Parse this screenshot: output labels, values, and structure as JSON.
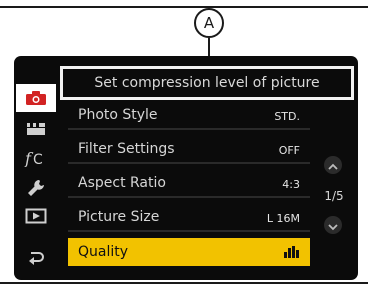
{
  "callout": {
    "label": "A"
  },
  "title": "Set compression level of picture",
  "sidebar": {
    "items": [
      {
        "icon": "camera-icon",
        "active": true
      },
      {
        "icon": "motion-picture-icon",
        "active": false
      },
      {
        "icon": "custom-fc-icon",
        "active": false
      },
      {
        "icon": "wrench-setup-icon",
        "active": false
      },
      {
        "icon": "playback-icon",
        "active": false
      },
      {
        "icon": "return-icon",
        "active": false
      }
    ]
  },
  "menu": {
    "items": [
      {
        "label": "Photo Style",
        "value": "STD."
      },
      {
        "label": "Filter Settings",
        "value": "OFF"
      },
      {
        "label": "Aspect Ratio",
        "value": "4:3"
      },
      {
        "label": "Picture Size",
        "value": "L 16M"
      },
      {
        "label": "Quality",
        "value": "fine-quality-icon",
        "selected": true
      }
    ]
  },
  "pagination": {
    "page": "1/5"
  },
  "colors": {
    "highlight": "#f2c200",
    "screen": "#0b0b0b",
    "active_tab": "#ffffff",
    "camera_icon": "#d22323"
  }
}
